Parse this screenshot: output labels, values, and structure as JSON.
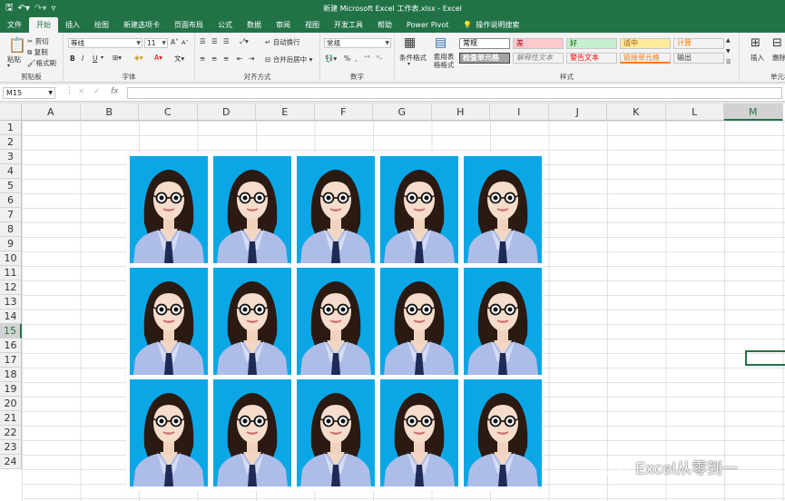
{
  "window": {
    "title": "新建 Microsoft Excel 工作表.xlsx  -  Excel"
  },
  "tabs": [
    {
      "label": "文件",
      "active": false
    },
    {
      "label": "开始",
      "active": true
    },
    {
      "label": "插入",
      "active": false
    },
    {
      "label": "绘图",
      "active": false
    },
    {
      "label": "新建选项卡",
      "active": false
    },
    {
      "label": "页面布局",
      "active": false
    },
    {
      "label": "公式",
      "active": false
    },
    {
      "label": "数据",
      "active": false
    },
    {
      "label": "审阅",
      "active": false
    },
    {
      "label": "视图",
      "active": false
    },
    {
      "label": "开发工具",
      "active": false
    },
    {
      "label": "帮助",
      "active": false
    },
    {
      "label": "Power Pivot",
      "active": false
    }
  ],
  "tell_me": "操作说明搜索",
  "ribbon": {
    "clipboard": {
      "paste": "粘贴",
      "cut": "剪切",
      "copy": "复制",
      "format_painter": "格式刷",
      "label": "剪贴板"
    },
    "font": {
      "name": "等线",
      "size": "11",
      "bold": "B",
      "italic": "I",
      "underline": "U",
      "grow": "A",
      "shrink": "A",
      "label": "字体"
    },
    "alignment": {
      "wrap": "自动换行",
      "merge": "合并后居中",
      "label": "对齐方式"
    },
    "number": {
      "format": "常规",
      "percent": "%",
      "label": "数字"
    },
    "styles": {
      "conditional": "条件格式",
      "table": "套用表格格式",
      "cells": [
        {
          "text": "常规",
          "bg": "#ffffff",
          "fg": "#000000"
        },
        {
          "text": "差",
          "bg": "#ffc7ce",
          "fg": "#9c0006"
        },
        {
          "text": "好",
          "bg": "#c6efce",
          "fg": "#006100"
        },
        {
          "text": "适中",
          "bg": "#ffeb9c",
          "fg": "#9c5700"
        },
        {
          "text": "计算",
          "bg": "#f2f2f2",
          "fg": "#fa7d00"
        },
        {
          "text": "检查单元格",
          "bg": "#a5a5a5",
          "fg": "#ffffff"
        },
        {
          "text": "解释性文本",
          "bg": "#f3f3f3",
          "fg": "#7f7f7f"
        },
        {
          "text": "警告文本",
          "bg": "#f3f3f3",
          "fg": "#ff0000"
        },
        {
          "text": "链接单元格",
          "bg": "#f3f3f3",
          "fg": "#fa7d00"
        },
        {
          "text": "输出",
          "bg": "#f2f2f2",
          "fg": "#3f3f3f"
        }
      ],
      "label": "样式"
    },
    "cells": {
      "insert": "插入",
      "delete": "删除",
      "label": "单元格"
    }
  },
  "formula_bar": {
    "name_box": "M15",
    "cancel": "×",
    "enter": "✓",
    "fx": "fx",
    "value": ""
  },
  "columns": [
    "A",
    "B",
    "C",
    "D",
    "E",
    "F",
    "G",
    "H",
    "I",
    "J",
    "K",
    "L",
    "M"
  ],
  "selected_column": "M",
  "rows": [
    "1",
    "2",
    "3",
    "4",
    "5",
    "6",
    "7",
    "8",
    "9",
    "10",
    "11",
    "12",
    "13",
    "14",
    "15",
    "16",
    "17",
    "18",
    "19",
    "20",
    "21",
    "22",
    "23",
    "24"
  ],
  "selected_row": "15",
  "photo_sheet": {
    "columns": 5,
    "rows": 3,
    "background": "#0aa7e7"
  },
  "watermark": {
    "text": "Excel从零到一"
  }
}
